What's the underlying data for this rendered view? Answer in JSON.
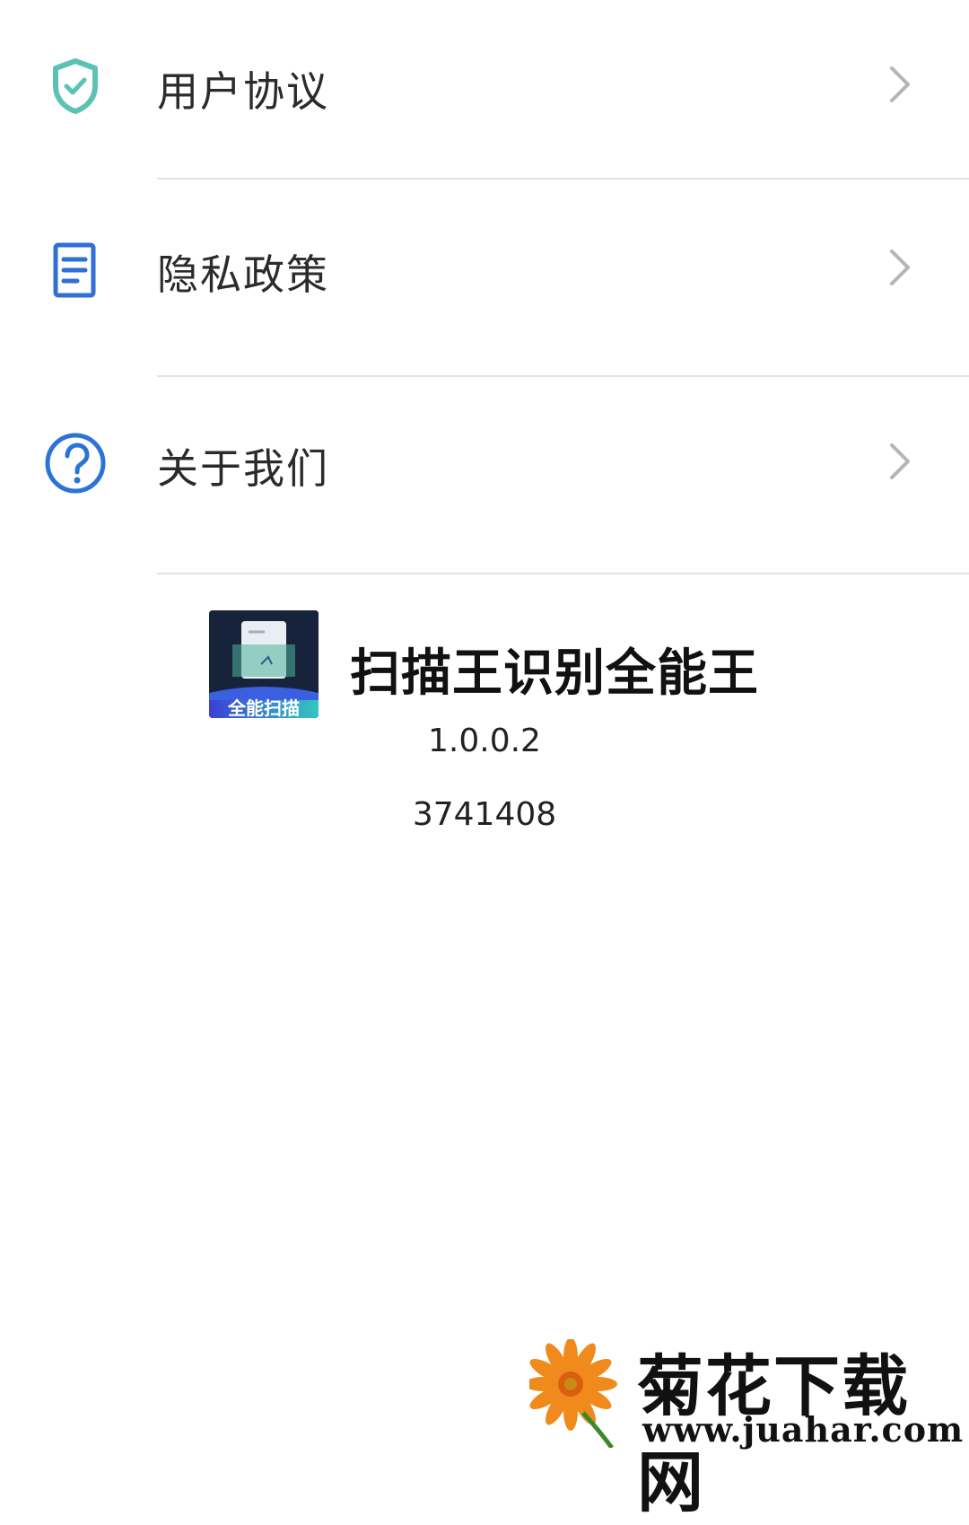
{
  "menu": {
    "items": [
      {
        "label": "用户协议",
        "icon": "shield-check-icon"
      },
      {
        "label": "隐私政策",
        "icon": "document-icon"
      },
      {
        "label": "关于我们",
        "icon": "question-circle-icon"
      }
    ]
  },
  "app": {
    "name": "扫描王识别全能王",
    "icon_text": "全能扫描",
    "version": "1.0.0.2",
    "build": "3741408"
  },
  "watermark": {
    "title": "菊花下载网",
    "url": "www.juahar.com"
  },
  "colors": {
    "shield": "#5cc3b4",
    "document": "#2f6fd6",
    "question": "#2a74d8",
    "chevron": "#b5b5b5",
    "divider": "#e3e3e3"
  }
}
